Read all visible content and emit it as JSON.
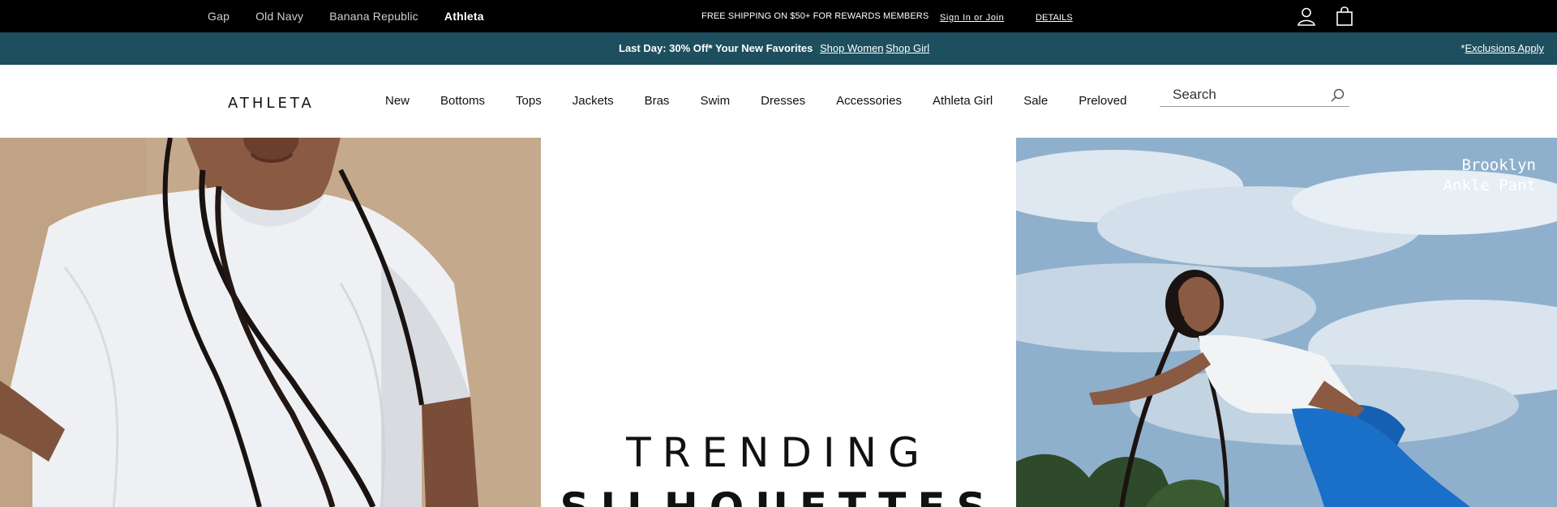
{
  "brandbar": {
    "brands": [
      "Gap",
      "Old Navy",
      "Banana Republic",
      "Athleta"
    ],
    "active_brand": "Athleta",
    "promo": "FREE SHIPPING ON $50+ FOR REWARDS MEMBERS",
    "signin": "Sign In or Join",
    "details": "DETAILS",
    "icons": [
      "account-icon",
      "shopping-bag-icon"
    ]
  },
  "promobar": {
    "message": "Last Day: 30% Off* Your New Favorites",
    "link_women": "Shop Women",
    "link_girl": "Shop Girl",
    "exclusions_prefix": "*",
    "exclusions": "Exclusions Apply",
    "background": "#1d4f5e"
  },
  "nav": {
    "logo": "ATHLETA",
    "items": [
      "New",
      "Bottoms",
      "Tops",
      "Jackets",
      "Bras",
      "Swim",
      "Dresses",
      "Accessories",
      "Athleta Girl",
      "Sale",
      "Preloved"
    ],
    "search_placeholder": "Search"
  },
  "hero": {
    "heading_line1": "TRENDING",
    "heading_line2": "SILHOUETTES",
    "product_label_line1": "Brooklyn",
    "product_label_line2": "Ankle Pant"
  }
}
